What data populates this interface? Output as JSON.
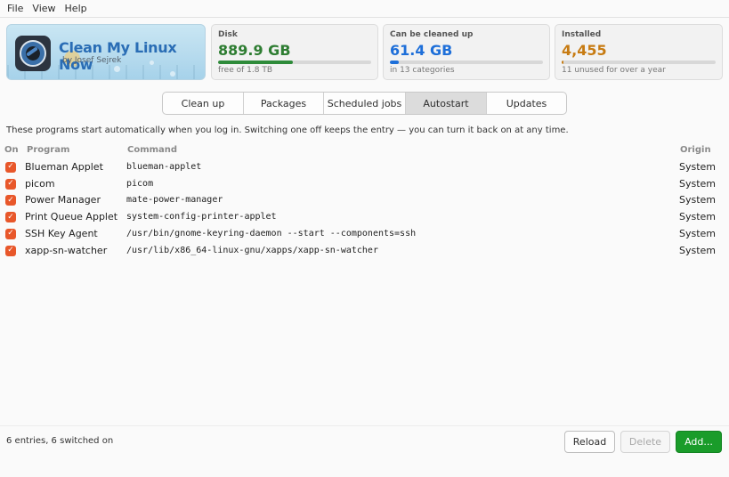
{
  "menu": [
    "File",
    "View",
    "Help"
  ],
  "brand": {
    "title": "Clean My Linux Now",
    "author": "by Josef Sejrek"
  },
  "cards": {
    "disk": {
      "label": "Disk",
      "value": "889.9 GB",
      "sub": "free of 1.8 TB",
      "fill_fraction": 0.49,
      "color": "#2e7d32",
      "fill_color": "#2e8b3a"
    },
    "clean": {
      "label": "Can be cleaned up",
      "value": "61.4 GB",
      "sub": "in 13 categories",
      "fill_fraction": 0.06,
      "color": "#1e6fd9",
      "fill_color": "#1e6fd9"
    },
    "installed": {
      "label": "Installed",
      "value": "4,455",
      "sub": "11 unused for over a year",
      "fill_fraction": 0.01,
      "color": "#c77b12",
      "fill_color": "#c77b12"
    }
  },
  "tabs": [
    {
      "label": "Clean up",
      "active": false
    },
    {
      "label": "Packages",
      "active": false
    },
    {
      "label": "Scheduled jobs",
      "active": false
    },
    {
      "label": "Autostart",
      "active": true
    },
    {
      "label": "Updates",
      "active": false
    }
  ],
  "intro": "These programs start automatically when you log in. Switching one off keeps the entry — you can turn it back on at any time.",
  "table": {
    "headers": {
      "on": "On",
      "program": "Program",
      "command": "Command",
      "origin": "Origin"
    },
    "rows": [
      {
        "on": true,
        "program": "Blueman Applet",
        "command": "blueman-applet",
        "origin": "System"
      },
      {
        "on": true,
        "program": "picom",
        "command": "picom",
        "origin": "System"
      },
      {
        "on": true,
        "program": "Power Manager",
        "command": "mate-power-manager",
        "origin": "System"
      },
      {
        "on": true,
        "program": "Print Queue Applet",
        "command": "system-config-printer-applet",
        "origin": "System"
      },
      {
        "on": true,
        "program": "SSH Key Agent",
        "command": "/usr/bin/gnome-keyring-daemon --start --components=ssh",
        "origin": "System"
      },
      {
        "on": true,
        "program": "xapp-sn-watcher",
        "command": "/usr/lib/x86_64-linux-gnu/xapps/xapp-sn-watcher",
        "origin": "System"
      }
    ]
  },
  "footer": {
    "status": "6 entries, 6 switched on",
    "reload": "Reload",
    "delete": "Delete",
    "add": "Add..."
  },
  "icons": {
    "checkbox": "checkmark-icon",
    "logo": "app-logo-icon"
  }
}
